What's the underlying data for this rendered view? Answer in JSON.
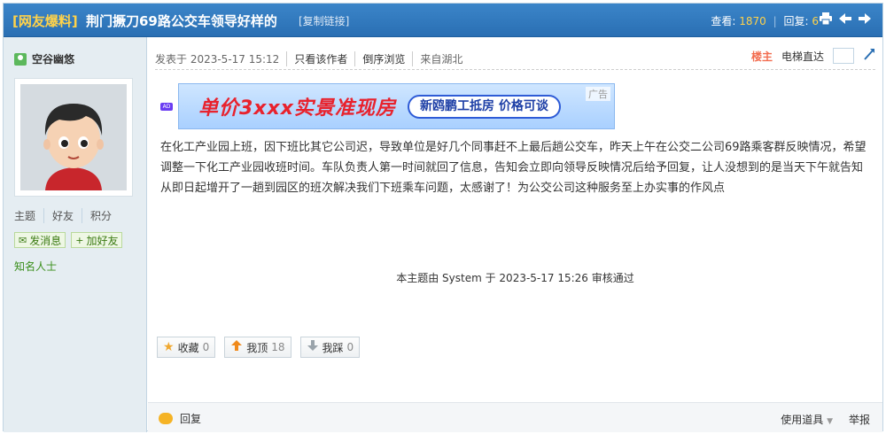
{
  "header": {
    "category": "[网友爆料]",
    "title": "荆门撅刀69路公交车领导好样的",
    "copy_link": "[复制链接]",
    "views_label": "查看:",
    "views": "1870",
    "replies_label": "回复:",
    "replies": "6",
    "icons": [
      "print-icon",
      "prev-arrow-icon",
      "next-arrow-icon"
    ]
  },
  "author": {
    "name": "空谷幽悠",
    "stats": [
      "主题",
      "好友",
      "积分"
    ],
    "send_message": "发消息",
    "add_friend": "加好友",
    "rank": "知名人士"
  },
  "post": {
    "posted": "发表于 2023-5-17 15:12",
    "only_author": "只看该作者",
    "reverse": "倒序浏览",
    "from": "来自湖北",
    "floor_label": "楼主",
    "elevator": "电梯直达",
    "ad_main": "单价3xxx实景准现房",
    "ad_pill": "新鸥鹏工抵房 价格可谈",
    "ad_label": "广告",
    "ad_tag": "AD",
    "content": "在化工产业园上班，因下班比其它公司迟，导致单位是好几个同事赶不上最后趟公交车，昨天上午在公交二公司69路乘客群反映情况，希望调整一下化工产业园收班时间。车队负责人第一时间就回了信息，告知会立即向领导反映情况后给予回复，让人没想到的是当天下午就告知从即日起增开了一趟到园区的班次解决我们下班乘车问题，太感谢了！为公交公司这种服务至上办实事的作风点",
    "audit": "本主题由 System 于 2023-5-17 15:26 审核通过"
  },
  "actions": {
    "favorite_label": "收藏",
    "favorite_count": "0",
    "upvote_label": "我顶",
    "upvote_count": "18",
    "downvote_label": "我踩",
    "downvote_count": "0"
  },
  "footer": {
    "reply": "回复",
    "tools": "使用道具",
    "report": "举报"
  },
  "colors": {
    "header_bg": "#2a6fb3",
    "sidebar_bg": "#e5edf2",
    "accent_orange": "#f26c4f"
  }
}
